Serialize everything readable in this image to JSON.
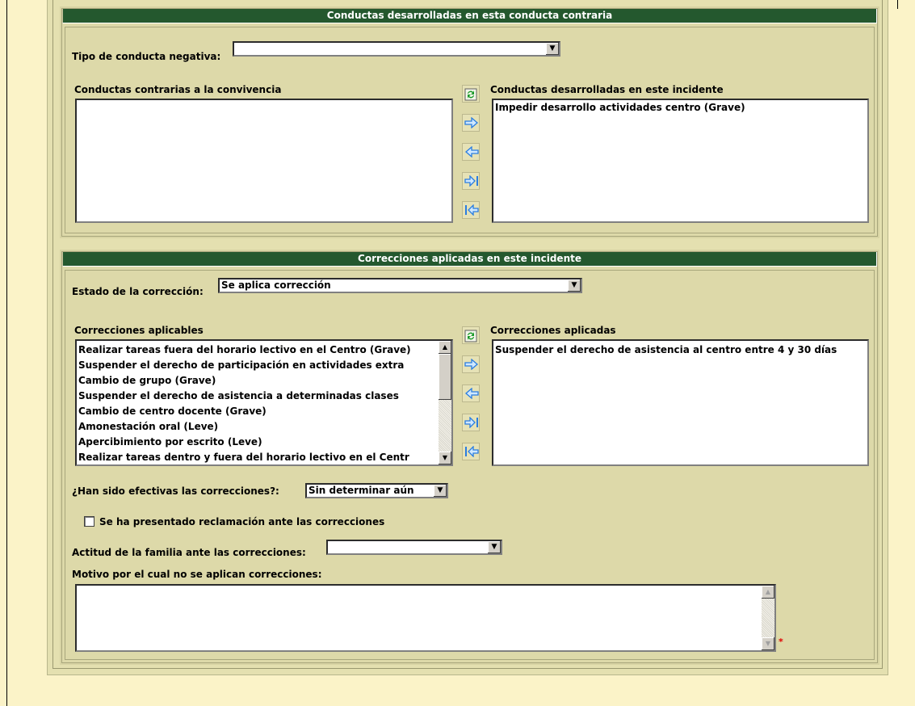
{
  "conductas": {
    "header": "Conductas desarrolladas en esta conducta contraria",
    "tipo_label": "Tipo de conducta negativa:",
    "tipo_value": "",
    "contrarias_label": "Conductas contrarias a la convivencia",
    "contrarias_items": [],
    "desarrolladas_label": "Conductas desarrolladas en este incidente",
    "desarrolladas_items": [
      "Impedir desarrollo actividades centro (Grave)"
    ]
  },
  "correcciones": {
    "header": "Correcciones aplicadas en este incidente",
    "estado_label": "Estado de la corrección:",
    "estado_value": "Se aplica corrección",
    "aplicables_label": "Correcciones aplicables",
    "aplicables_items": [
      "Realizar tareas fuera del horario lectivo en el Centro (Grave)",
      "Suspender el derecho de participación en actividades extra",
      "Cambio de grupo (Grave)",
      "Suspender el derecho de asistencia a determinadas clases",
      "Cambio de centro docente (Grave)",
      "Amonestación oral (Leve)",
      "Apercibimiento por escrito (Leve)",
      "Realizar tareas dentro y fuera del horario lectivo en el Centr"
    ],
    "aplicadas_label": "Correcciones aplicadas",
    "aplicadas_items": [
      "Suspender el derecho de asistencia al centro entre 4 y 30 días"
    ],
    "efectivas_label": "¿Han sido efectivas las correcciones?:",
    "efectivas_value": "Sin determinar aún",
    "reclamacion_label": "Se ha presentado reclamación ante las correcciones",
    "reclamacion_checked": false,
    "actitud_label": "Actitud de la familia ante las correcciones:",
    "actitud_value": "",
    "motivo_label": "Motivo por el cual no se aplican correcciones:",
    "motivo_value": "",
    "required_mark": "*"
  },
  "icons": {
    "refresh": "refresh-icon",
    "move_right": "arrow-right-icon",
    "move_left": "arrow-left-icon",
    "move_all_right": "arrow-right-bar-icon",
    "move_all_left": "arrow-left-bar-icon"
  },
  "colors": {
    "header_bg": "#24582e",
    "panel_bg": "#ddd9a9",
    "page_bg": "#fbf3c8",
    "arrow_blue": "#2a7de0",
    "required": "#e00000"
  }
}
